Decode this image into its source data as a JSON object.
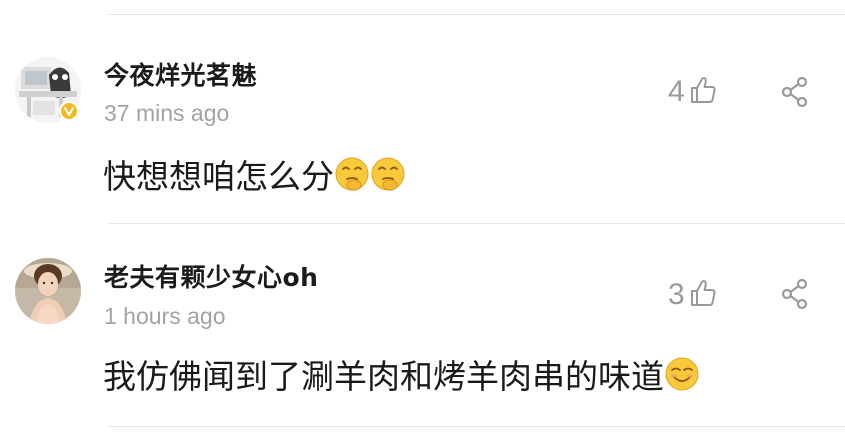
{
  "comments": [
    {
      "username": "今夜烊光茗魅",
      "time": "37  mins ago",
      "text": "快想想咱怎么分",
      "emojis": [
        "thinking-emoji",
        "thinking-emoji"
      ],
      "likes": "4",
      "verified": true
    },
    {
      "username": "老夫有颗少女心oh",
      "time": "1 hours ago",
      "text": "我仿佛闻到了涮羊肉和烤羊肉串的味道",
      "emojis": [
        "smiling-emoji"
      ],
      "likes": "3",
      "verified": false
    }
  ],
  "colors": {
    "verified_badge": "#f5b81e",
    "emoji_face": "#f9c93c",
    "icon_gray": "#9a9a9a"
  }
}
